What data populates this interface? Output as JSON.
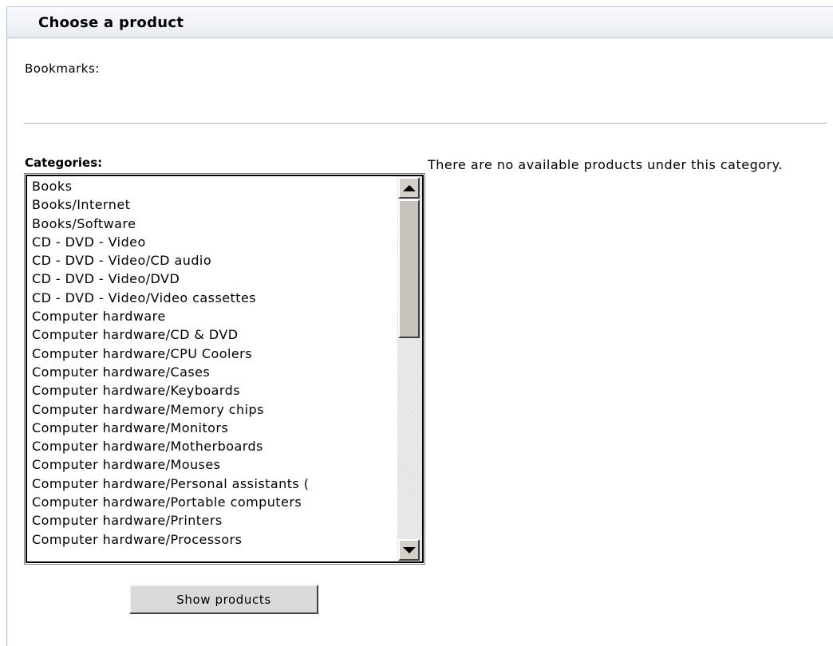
{
  "header": {
    "title": "Choose a product"
  },
  "bookmarks": {
    "label": "Bookmarks:"
  },
  "categories": {
    "label": "Categories:",
    "items": [
      "Books",
      "Books/Internet",
      "Books/Software",
      "CD - DVD - Video",
      "CD - DVD - Video/CD audio",
      "CD - DVD - Video/DVD",
      "CD - DVD - Video/Video cassettes",
      "Computer hardware",
      "Computer hardware/CD & DVD",
      "Computer hardware/CPU Coolers",
      "Computer hardware/Cases",
      "Computer hardware/Keyboards",
      "Computer hardware/Memory chips",
      "Computer hardware/Monitors",
      "Computer hardware/Motherboards",
      "Computer hardware/Mouses",
      "Computer hardware/Personal assistants (",
      "Computer hardware/Portable computers",
      "Computer hardware/Printers",
      "Computer hardware/Processors"
    ]
  },
  "message": {
    "text": "There are no available products under this category."
  },
  "actions": {
    "show_products_label": "Show products"
  },
  "icons": {
    "scroll_up": "triangle-up-icon",
    "scroll_down": "triangle-down-icon"
  },
  "colors": {
    "header_background": "#eef1f5",
    "divider": "#a9b7c6",
    "button_face": "#d9d9d9"
  }
}
